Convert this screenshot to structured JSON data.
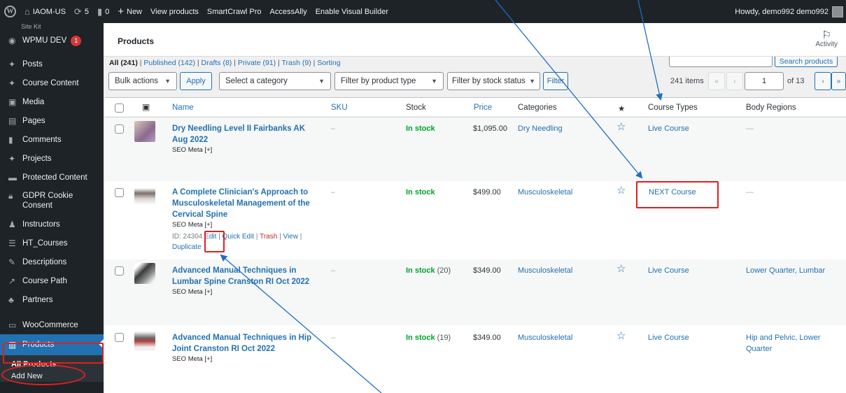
{
  "adminbar": {
    "site_name": "IAOM-US",
    "updates": "5",
    "comments": "0",
    "new_label": "New",
    "links": [
      "View products",
      "SmartCrawl Pro",
      "AccessAlly",
      "Enable Visual Builder"
    ],
    "greeting": "Howdy, demo992 demo992"
  },
  "sidebar": {
    "top_cut": "Site Kit",
    "wpmu": {
      "label": "WPMU DEV",
      "badge": "1"
    },
    "items": [
      "Posts",
      "Course Content",
      "Media",
      "Pages",
      "Comments",
      "Projects",
      "Protected Content",
      "GDPR Cookie Consent",
      "Instructors",
      "HT_Courses",
      "Descriptions",
      "Course Path",
      "Partners"
    ],
    "woocommerce": "WooCommerce",
    "products": "Products",
    "sub": [
      "All Products",
      "Add New"
    ]
  },
  "header": {
    "title": "Products",
    "activity": "Activity"
  },
  "views": {
    "all": "All (241)",
    "published": "Published (142)",
    "drafts": "Drafts (8)",
    "private": "Private (91)",
    "trash": "Trash (9)",
    "sorting": "Sorting"
  },
  "search": {
    "button": "Search products"
  },
  "filters": {
    "bulk": "Bulk actions",
    "apply": "Apply",
    "category": "Select a category",
    "product_type": "Filter by product type",
    "stock_status": "Filter by stock status",
    "filter": "Filter"
  },
  "pagination": {
    "items": "241 items",
    "first": "«",
    "prev": "‹",
    "current": "1",
    "of": "of 13",
    "next": "›",
    "last": "»"
  },
  "columns": {
    "name": "Name",
    "sku": "SKU",
    "stock": "Stock",
    "price": "Price",
    "categories": "Categories",
    "featured": "★",
    "course_types": "Course Types",
    "body_regions": "Body Regions"
  },
  "rows": [
    {
      "title": "Dry Needling Level II Fairbanks AK Aug 2022",
      "seo": "SEO Meta [+]",
      "sku": "–",
      "stock": "In stock",
      "qty": "",
      "price": "$1,095.00",
      "category": "Dry Needling",
      "course_type": "Live Course",
      "body_regions": "—"
    },
    {
      "title": "A Complete Clinician's Approach to Musculoskeletal Management of the Cervical Spine",
      "seo": "SEO Meta [+]",
      "id": "ID: 24304",
      "actions": {
        "edit": "Edit",
        "quick_edit": "Quick Edit",
        "trash": "Trash",
        "view": "View",
        "duplicate": "Duplicate"
      },
      "sku": "–",
      "stock": "In stock",
      "qty": "",
      "price": "$499.00",
      "category": "Musculoskeletal",
      "course_type": "NEXT Course",
      "body_regions": "—"
    },
    {
      "title": "Advanced Manual Techniques in Lumbar Spine Cranston RI Oct 2022",
      "seo": "SEO Meta [+]",
      "sku": "–",
      "stock": "In stock",
      "qty": "(20)",
      "price": "$349.00",
      "category": "Musculoskeletal",
      "course_type": "Live Course",
      "body_regions": "Lower Quarter, Lumbar"
    },
    {
      "title": "Advanced Manual Techniques in Hip Joint Cranston RI Oct 2022",
      "seo": "SEO Meta [+]",
      "sku": "–",
      "stock": "In stock",
      "qty": "(19)",
      "price": "$349.00",
      "category": "Musculoskeletal",
      "course_type": "Live Course",
      "body_regions": "Hip and Pelvic, Lower Quarter"
    }
  ],
  "colors": {
    "link": "#2271b1",
    "adminbar": "#1d2327",
    "active": "#2271b1",
    "instock": "#00a32a",
    "annotation": "#e02020",
    "arrow": "#1e6fc5"
  }
}
